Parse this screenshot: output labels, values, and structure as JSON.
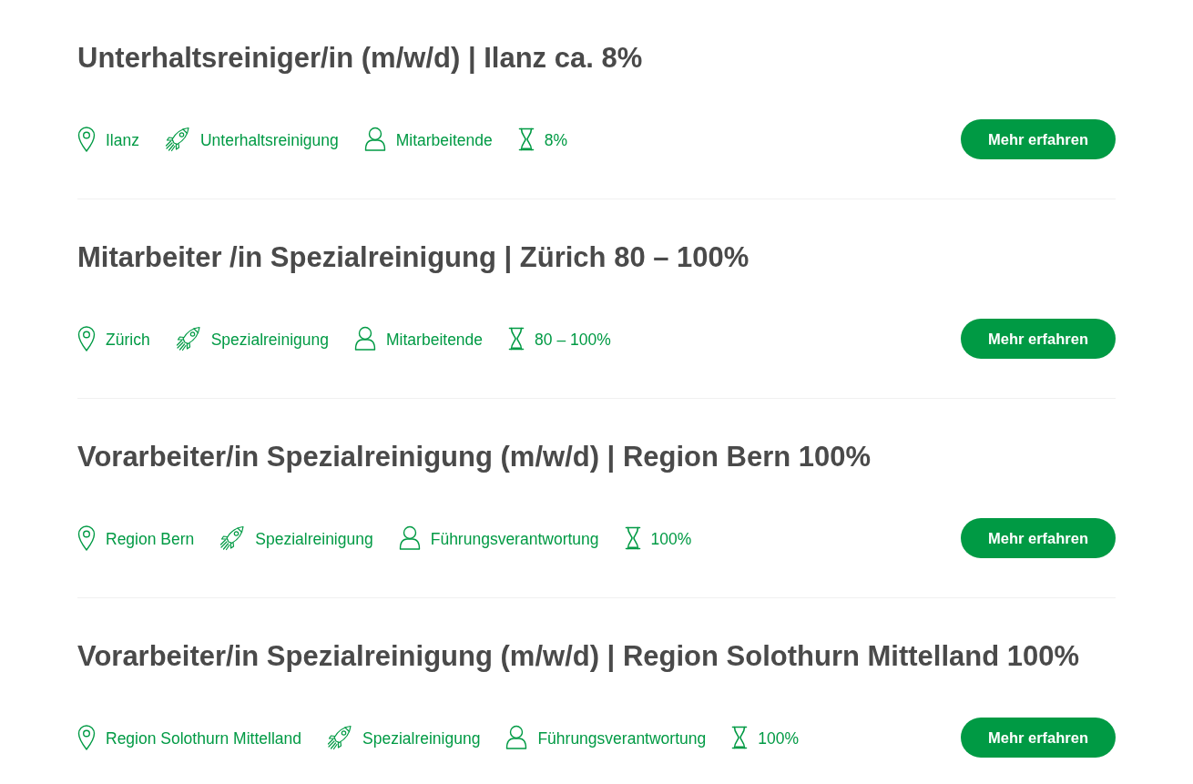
{
  "jobs": [
    {
      "title": "Unterhaltsreiniger/in (m/w/d) | Ilanz ca. 8%",
      "meta": [
        {
          "kind": "location",
          "text": "Ilanz"
        },
        {
          "kind": "category",
          "text": "Unterhaltsreinigung"
        },
        {
          "kind": "role",
          "text": "Mitarbeitende"
        },
        {
          "kind": "workload",
          "text": "8%"
        }
      ],
      "button": "Mehr erfahren"
    },
    {
      "title": "Mitarbeiter /in Spezialreinigung | Zürich 80 – 100%",
      "meta": [
        {
          "kind": "location",
          "text": "Zürich"
        },
        {
          "kind": "category",
          "text": "Spezialreinigung"
        },
        {
          "kind": "role",
          "text": "Mitarbeitende"
        },
        {
          "kind": "workload",
          "text": "80 – 100%"
        }
      ],
      "button": "Mehr erfahren"
    },
    {
      "title": "Vorarbeiter/in Spezialreinigung (m/w/d) | Region Bern 100%",
      "meta": [
        {
          "kind": "location",
          "text": "Region Bern"
        },
        {
          "kind": "category",
          "text": "Spezialreinigung"
        },
        {
          "kind": "role",
          "text": "Führungsverantwortung"
        },
        {
          "kind": "workload",
          "text": "100%"
        }
      ],
      "button": "Mehr erfahren"
    },
    {
      "title": "Vorarbeiter/in Spezialreinigung (m/w/d) | Region Solothurn Mittelland 100%",
      "meta": [
        {
          "kind": "location",
          "text": "Region Solothurn Mittelland"
        },
        {
          "kind": "category",
          "text": "Spezialreinigung"
        },
        {
          "kind": "role",
          "text": "Führungsverantwortung"
        },
        {
          "kind": "workload",
          "text": "100%"
        }
      ],
      "button": "Mehr erfahren"
    }
  ]
}
